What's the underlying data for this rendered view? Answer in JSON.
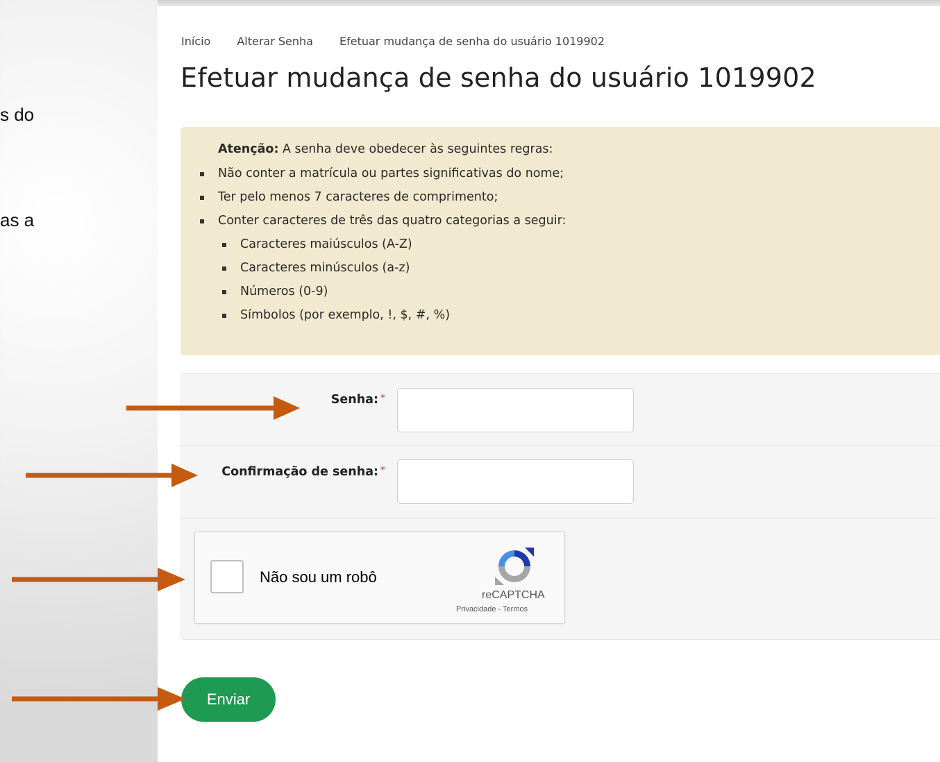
{
  "side_text": {
    "line1": "s do",
    "line2": "as a"
  },
  "breadcrumb": [
    "Início",
    "Alterar Senha",
    "Efetuar mudança de senha do usuário 1019902"
  ],
  "page_title": "Efetuar mudança de senha do usuário 1019902",
  "alert": {
    "lead_bold": "Atenção:",
    "lead_text": " A senha deve obedecer às seguintes regras:",
    "rules": [
      "Não conter a matrícula ou partes significativas do nome;",
      "Ter pelo menos 7 caracteres de comprimento;",
      "Conter caracteres de três das quatro categorias a seguir:"
    ],
    "categories": [
      "Caracteres maiúsculos (A-Z)",
      "Caracteres minúsculos (a-z)",
      "Números (0-9)",
      "Símbolos (por exemplo, !, $, #, %)"
    ]
  },
  "form": {
    "password_label": "Senha:",
    "confirm_label": "Confirmação de senha:",
    "required_mark": "*",
    "password_value": "",
    "confirm_value": ""
  },
  "captcha": {
    "label": "Não sou um robô",
    "brand": "reCAPTCHA",
    "links": "Privacidade - Termos"
  },
  "submit_label": "Enviar",
  "colors": {
    "arrow": "#c55a11",
    "alert_bg": "#f2ead0",
    "button": "#1f9a52",
    "required": "#c0392b"
  }
}
